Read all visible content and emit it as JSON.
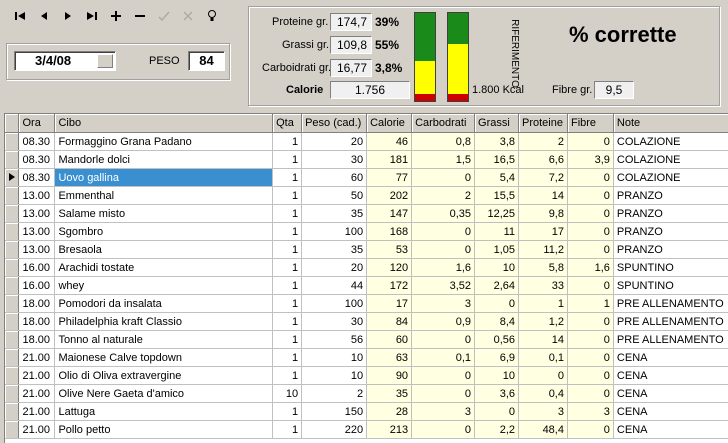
{
  "toolbar": {
    "buttons": [
      {
        "name": "first-record-button",
        "glyph": "|◀",
        "enabled": true
      },
      {
        "name": "prev-record-button",
        "glyph": "◀",
        "enabled": true
      },
      {
        "name": "next-record-button",
        "glyph": "▶",
        "enabled": true
      },
      {
        "name": "last-record-button",
        "glyph": "▶|",
        "enabled": true
      },
      {
        "name": "insert-record-button",
        "glyph": "+",
        "enabled": true
      },
      {
        "name": "delete-record-button",
        "glyph": "−",
        "enabled": true
      },
      {
        "name": "post-edit-button",
        "glyph": "✓",
        "enabled": false
      },
      {
        "name": "cancel-edit-button",
        "glyph": "✕",
        "enabled": false
      },
      {
        "name": "refresh-button",
        "glyph": "💡",
        "enabled": true
      }
    ]
  },
  "date": {
    "value": "3/4/08"
  },
  "peso": {
    "label": "PESO",
    "value": "84"
  },
  "summary": {
    "proteine": {
      "label": "Proteine gr.",
      "value": "174,7",
      "pct": "39%"
    },
    "grassi": {
      "label": "Grassi gr.",
      "value": "109,8",
      "pct": "55%"
    },
    "carboidrati": {
      "label": "Carboidrati gr.",
      "value": "16,77",
      "pct": "3,8%"
    },
    "calorie": {
      "label": "Calorie",
      "value": "1.756"
    }
  },
  "bars": {
    "bar1": {
      "green_fraction": 0.55,
      "yellow_fraction": 0.37,
      "red_fraction": 0.08
    },
    "bar2": {
      "green_fraction": 0.35,
      "yellow_fraction": 0.57,
      "red_fraction": 0.08
    },
    "kcal_label": "1.800 Kcal",
    "riferimento_label": "RIFERIMENTO"
  },
  "fibre": {
    "label": "Fibre gr.",
    "value": "9,5"
  },
  "headline": "% corrette",
  "colors": {
    "green": "#1a8a1a",
    "yellow": "#ffff00",
    "red": "#cc0000",
    "selection": "#3a8fd0",
    "cell_yellow": "#ffffe1"
  },
  "table": {
    "columns": [
      "Ora",
      "Cibo",
      "Qta",
      "Peso (cad.)",
      "Calorie",
      "Carbodrati",
      "Grassi",
      "Proteine",
      "Fibre",
      "Note"
    ],
    "selected_row": 2,
    "rows": [
      [
        "08.30",
        "Formaggino Grana Padano",
        "1",
        "20",
        "46",
        "0,8",
        "3,8",
        "2",
        "0",
        "COLAZIONE"
      ],
      [
        "08.30",
        "Mandorle dolci",
        "1",
        "30",
        "181",
        "1,5",
        "16,5",
        "6,6",
        "3,9",
        "COLAZIONE"
      ],
      [
        "08.30",
        "Uovo gallina",
        "1",
        "60",
        "77",
        "0",
        "5,4",
        "7,2",
        "0",
        "COLAZIONE"
      ],
      [
        "13.00",
        "Emmenthal",
        "1",
        "50",
        "202",
        "2",
        "15,5",
        "14",
        "0",
        "PRANZO"
      ],
      [
        "13.00",
        "Salame misto",
        "1",
        "35",
        "147",
        "0,35",
        "12,25",
        "9,8",
        "0",
        "PRANZO"
      ],
      [
        "13.00",
        "Sgombro",
        "1",
        "100",
        "168",
        "0",
        "11",
        "17",
        "0",
        "PRANZO"
      ],
      [
        "13.00",
        "Bresaola",
        "1",
        "35",
        "53",
        "0",
        "1,05",
        "11,2",
        "0",
        "PRANZO"
      ],
      [
        "16.00",
        "Arachidi tostate",
        "1",
        "20",
        "120",
        "1,6",
        "10",
        "5,8",
        "1,6",
        "SPUNTINO"
      ],
      [
        "16.00",
        "whey",
        "1",
        "44",
        "172",
        "3,52",
        "2,64",
        "33",
        "0",
        "SPUNTINO"
      ],
      [
        "18.00",
        "Pomodori da insalata",
        "1",
        "100",
        "17",
        "3",
        "0",
        "1",
        "1",
        "PRE ALLENAMENTO"
      ],
      [
        "18.00",
        "Philadelphia kraft Classio",
        "1",
        "30",
        "84",
        "0,9",
        "8,4",
        "1,2",
        "0",
        "PRE ALLENAMENTO"
      ],
      [
        "18.00",
        "Tonno al naturale",
        "1",
        "56",
        "60",
        "0",
        "0,56",
        "14",
        "0",
        "PRE ALLENAMENTO"
      ],
      [
        "21.00",
        "Maionese Calve topdown",
        "1",
        "10",
        "63",
        "0,1",
        "6,9",
        "0,1",
        "0",
        "CENA"
      ],
      [
        "21.00",
        "Olio di Oliva extravergine",
        "1",
        "10",
        "90",
        "0",
        "10",
        "0",
        "0",
        "CENA"
      ],
      [
        "21.00",
        "Olive Nere Gaeta d'amico",
        "10",
        "2",
        "35",
        "0",
        "3,6",
        "0,4",
        "0",
        "CENA"
      ],
      [
        "21.00",
        "Lattuga",
        "1",
        "150",
        "28",
        "3",
        "0",
        "3",
        "3",
        "CENA"
      ],
      [
        "21.00",
        "Pollo petto",
        "1",
        "220",
        "213",
        "0",
        "2,2",
        "48,4",
        "0",
        "CENA"
      ]
    ]
  }
}
